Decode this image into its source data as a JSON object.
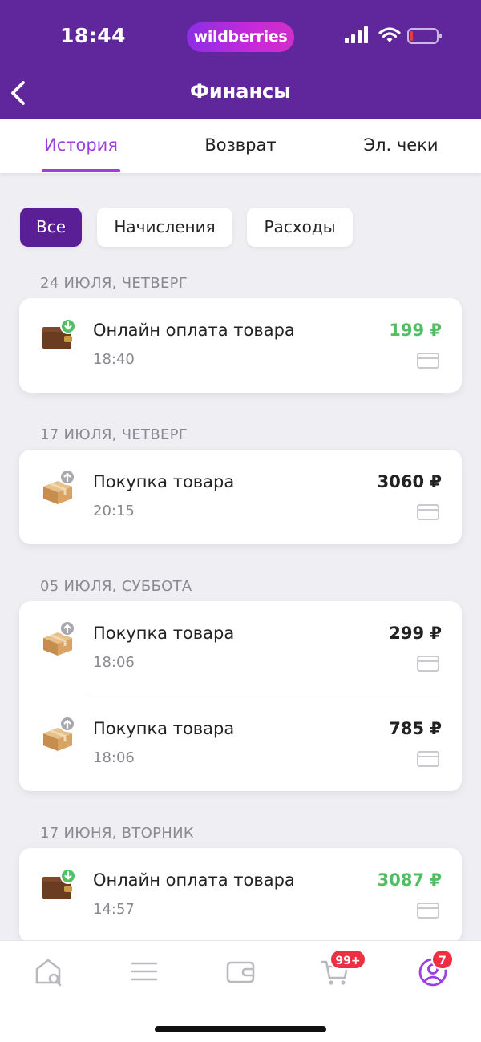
{
  "status_bar": {
    "time": "18:44",
    "brand": "wildberries"
  },
  "header": {
    "title": "Финансы"
  },
  "tabs": [
    {
      "label": "История",
      "active": true
    },
    {
      "label": "Возврат",
      "active": false
    },
    {
      "label": "Эл. чеки",
      "active": false
    }
  ],
  "filters": [
    {
      "label": "Все",
      "active": true
    },
    {
      "label": "Начисления",
      "active": false
    },
    {
      "label": "Расходы",
      "active": false
    }
  ],
  "groups": [
    {
      "date": "24 ИЮЛЯ, ЧЕТВЕРГ",
      "items": [
        {
          "title": "Онлайн оплата товара",
          "time": "18:40",
          "amount": "199 ₽",
          "kind": "income",
          "icon": "wallet-download-icon"
        }
      ]
    },
    {
      "date": "17 ИЮЛЯ, ЧЕТВЕРГ",
      "items": [
        {
          "title": "Покупка товара",
          "time": "20:15",
          "amount": "3060 ₽",
          "kind": "expense",
          "icon": "box-upload-icon"
        }
      ]
    },
    {
      "date": "05 ИЮЛЯ, СУББОТА",
      "items": [
        {
          "title": "Покупка товара",
          "time": "18:06",
          "amount": "299 ₽",
          "kind": "expense",
          "icon": "box-upload-icon"
        },
        {
          "title": "Покупка товара",
          "time": "18:06",
          "amount": "785 ₽",
          "kind": "expense",
          "icon": "box-upload-icon"
        }
      ]
    },
    {
      "date": "17 ИЮНЯ, ВТОРНИК",
      "items": [
        {
          "title": "Онлайн оплата товара",
          "time": "14:57",
          "amount": "3087 ₽",
          "kind": "income",
          "icon": "wallet-download-icon"
        }
      ]
    }
  ],
  "bottom_nav": {
    "items": [
      {
        "icon": "home-search-icon"
      },
      {
        "icon": "menu-icon"
      },
      {
        "icon": "wallet-icon"
      },
      {
        "icon": "cart-icon",
        "badge": "99+"
      },
      {
        "icon": "profile-icon",
        "badge": "7",
        "active": true
      }
    ]
  },
  "colors": {
    "header": "#60279c",
    "accent": "#9b3fe0",
    "income": "#50bf63",
    "badge": "#ee3045"
  }
}
